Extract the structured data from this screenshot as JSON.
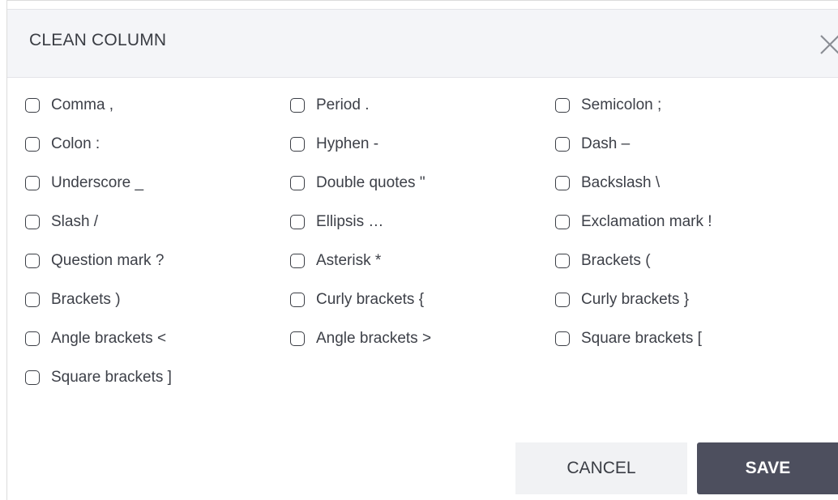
{
  "dialog": {
    "title": "CLEAN COLUMN",
    "close_icon": "close-icon"
  },
  "options": [
    {
      "label": "Comma ,",
      "checked": false
    },
    {
      "label": "Period .",
      "checked": false
    },
    {
      "label": "Semicolon ;",
      "checked": false
    },
    {
      "label": "Colon :",
      "checked": false
    },
    {
      "label": "Hyphen -",
      "checked": false
    },
    {
      "label": "Dash –",
      "checked": false
    },
    {
      "label": "Underscore _",
      "checked": false
    },
    {
      "label": "Double quotes \"",
      "checked": false
    },
    {
      "label": "Backslash \\",
      "checked": false
    },
    {
      "label": "Slash /",
      "checked": false
    },
    {
      "label": "Ellipsis …",
      "checked": false
    },
    {
      "label": "Exclamation mark !",
      "checked": false
    },
    {
      "label": "Question mark ?",
      "checked": false
    },
    {
      "label": "Asterisk *",
      "checked": false
    },
    {
      "label": "Brackets (",
      "checked": false
    },
    {
      "label": "Brackets )",
      "checked": false
    },
    {
      "label": "Curly brackets {",
      "checked": false
    },
    {
      "label": "Curly brackets }",
      "checked": false
    },
    {
      "label": "Angle brackets <",
      "checked": false
    },
    {
      "label": "Angle brackets >",
      "checked": false
    },
    {
      "label": "Square brackets [",
      "checked": false
    },
    {
      "label": "Square brackets ]",
      "checked": false
    }
  ],
  "buttons": {
    "cancel_label": "CANCEL",
    "save_label": "SAVE"
  },
  "colors": {
    "header_bg": "#f4f5f8",
    "save_bg": "#4d4f5e",
    "cancel_bg": "#f1f2f4",
    "text": "#3d4048"
  }
}
